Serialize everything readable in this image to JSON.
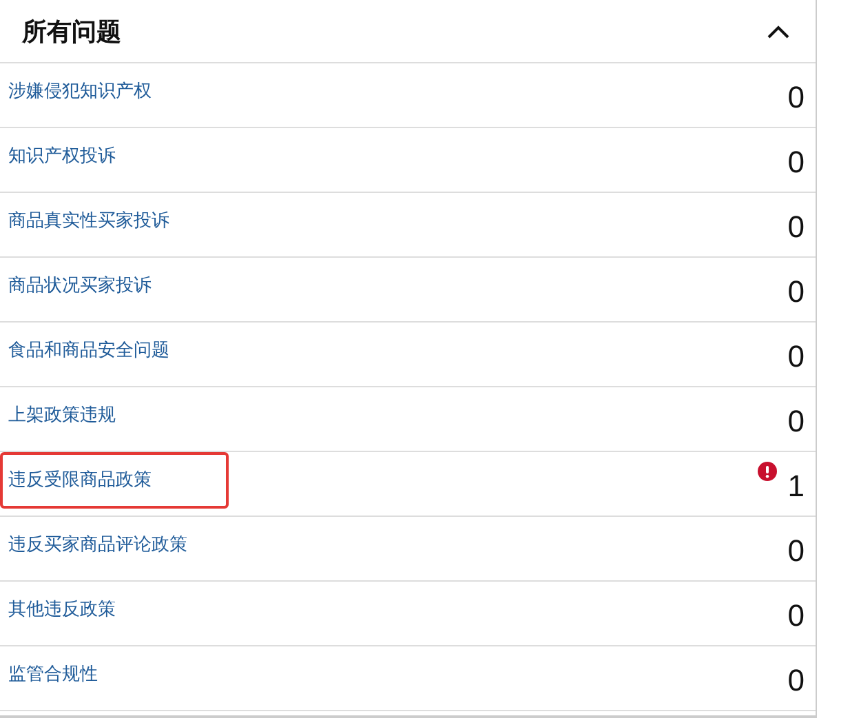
{
  "section": {
    "title": "所有问题",
    "expanded": true
  },
  "issues": [
    {
      "label": "涉嫌侵犯知识产权",
      "count": "0",
      "highlighted": false,
      "alert": false
    },
    {
      "label": "知识产权投诉",
      "count": "0",
      "highlighted": false,
      "alert": false
    },
    {
      "label": "商品真实性买家投诉",
      "count": "0",
      "highlighted": false,
      "alert": false
    },
    {
      "label": "商品状况买家投诉",
      "count": "0",
      "highlighted": false,
      "alert": false
    },
    {
      "label": "食品和商品安全问题",
      "count": "0",
      "highlighted": false,
      "alert": false
    },
    {
      "label": "上架政策违规",
      "count": "0",
      "highlighted": false,
      "alert": false
    },
    {
      "label": "违反受限商品政策",
      "count": "1",
      "highlighted": true,
      "alert": true
    },
    {
      "label": "违反买家商品评论政策",
      "count": "0",
      "highlighted": false,
      "alert": false
    },
    {
      "label": "其他违反政策",
      "count": "0",
      "highlighted": false,
      "alert": false
    },
    {
      "label": "监管合规性",
      "count": "0",
      "highlighted": false,
      "alert": false
    }
  ]
}
